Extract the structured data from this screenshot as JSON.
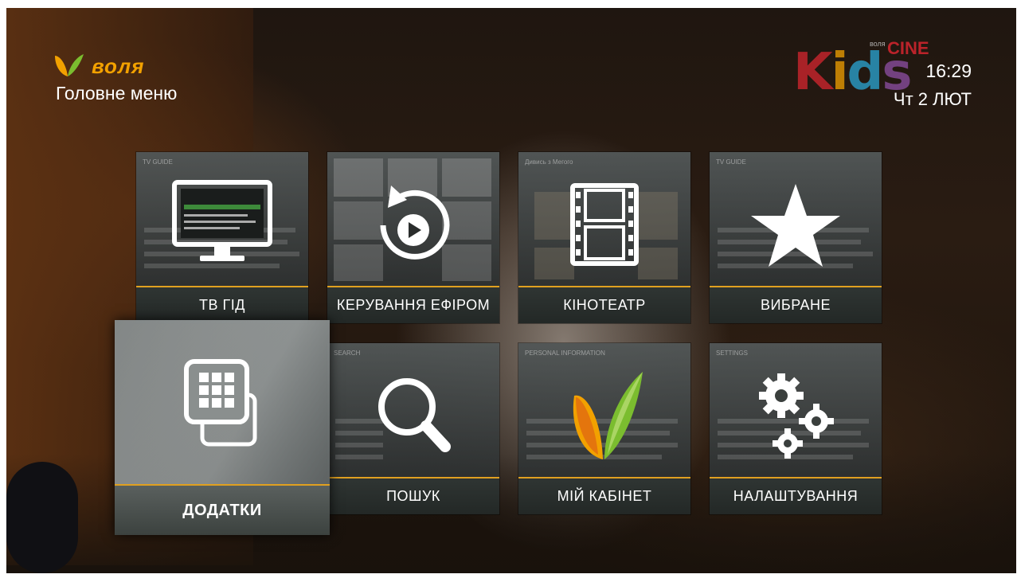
{
  "header": {
    "brand_name": "воля",
    "menu_title": "Головне меню",
    "channel_logo": {
      "brand_small": "воля",
      "cine": "CINE",
      "kids_letters": [
        "K",
        "i",
        "d",
        "s"
      ]
    },
    "time": "16:29",
    "date": "Чт 2 ЛЮТ"
  },
  "tiles": [
    {
      "label": "ТВ ГІД",
      "icon": "tv-monitor-icon",
      "preview_header": "TV GUIDE",
      "focused": false
    },
    {
      "label": "КЕРУВАННЯ ЕФІРОМ",
      "icon": "replay-play-icon",
      "preview_header": "",
      "focused": false
    },
    {
      "label": "КІНОТЕАТР",
      "icon": "film-strip-icon",
      "preview_header": "Дивись з Мегого",
      "focused": false
    },
    {
      "label": "ВИБРАНЕ",
      "icon": "star-icon",
      "preview_header": "TV GUIDE",
      "focused": false
    },
    {
      "label": "ДОДАТКИ",
      "icon": "apps-grid-icon",
      "preview_header": "",
      "focused": true
    },
    {
      "label": "ПОШУК",
      "icon": "search-icon",
      "preview_header": "SEARCH",
      "focused": false
    },
    {
      "label": "МІЙ КАБІНЕТ",
      "icon": "volya-logo-icon",
      "preview_header": "PERSONAL INFORMATION",
      "focused": false
    },
    {
      "label": "НАЛАШТУВАННЯ",
      "icon": "gears-icon",
      "preview_header": "SETTINGS",
      "focused": false
    }
  ],
  "colors": {
    "accent": "#f2a100",
    "label_bar": "#2f3533",
    "focus_tile": "#8d9292"
  }
}
